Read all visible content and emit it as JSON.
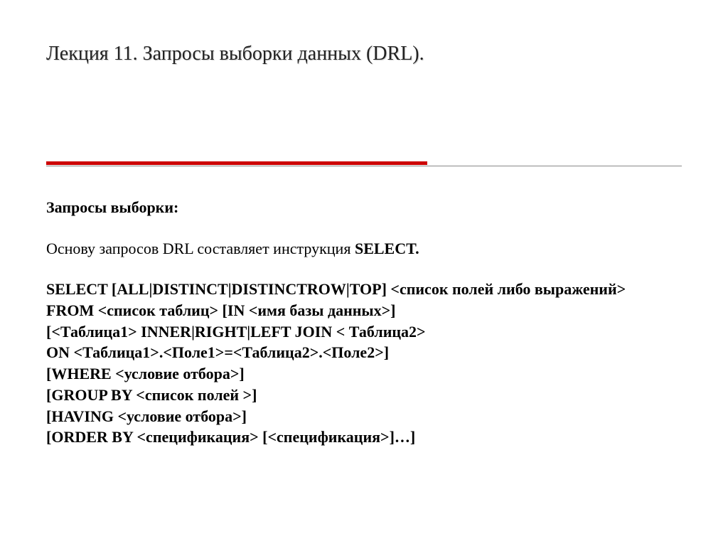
{
  "title": "Лекция 11. Запросы выборки данных (DRL).",
  "section_heading": "Запросы выборки:",
  "intro_prefix": "Основу запросов DRL составляет инструкция ",
  "intro_bold": "SELECT.",
  "syntax": {
    "l1": "SELECT [ALL|DISTINCT|DISTINCTROW|TOP] <список полей либо выражений>",
    "l2": "FROM <список таблиц> [IN <имя базы данных>]",
    "l3": "[<Таблица1> INNER|RIGHT|LEFT JOIN < Таблица2>",
    "l4": "ON <Таблица1>.<Поле1>=<Таблица2>.<Поле2>]",
    "l5": "[WHERE <условие отбора>]",
    "l6": "[GROUP BY <список полей >]",
    "l7": "[HAVING <условие отбора>]",
    "l8": "[ORDER BY <спецификация> [<спецификация>]…]"
  }
}
